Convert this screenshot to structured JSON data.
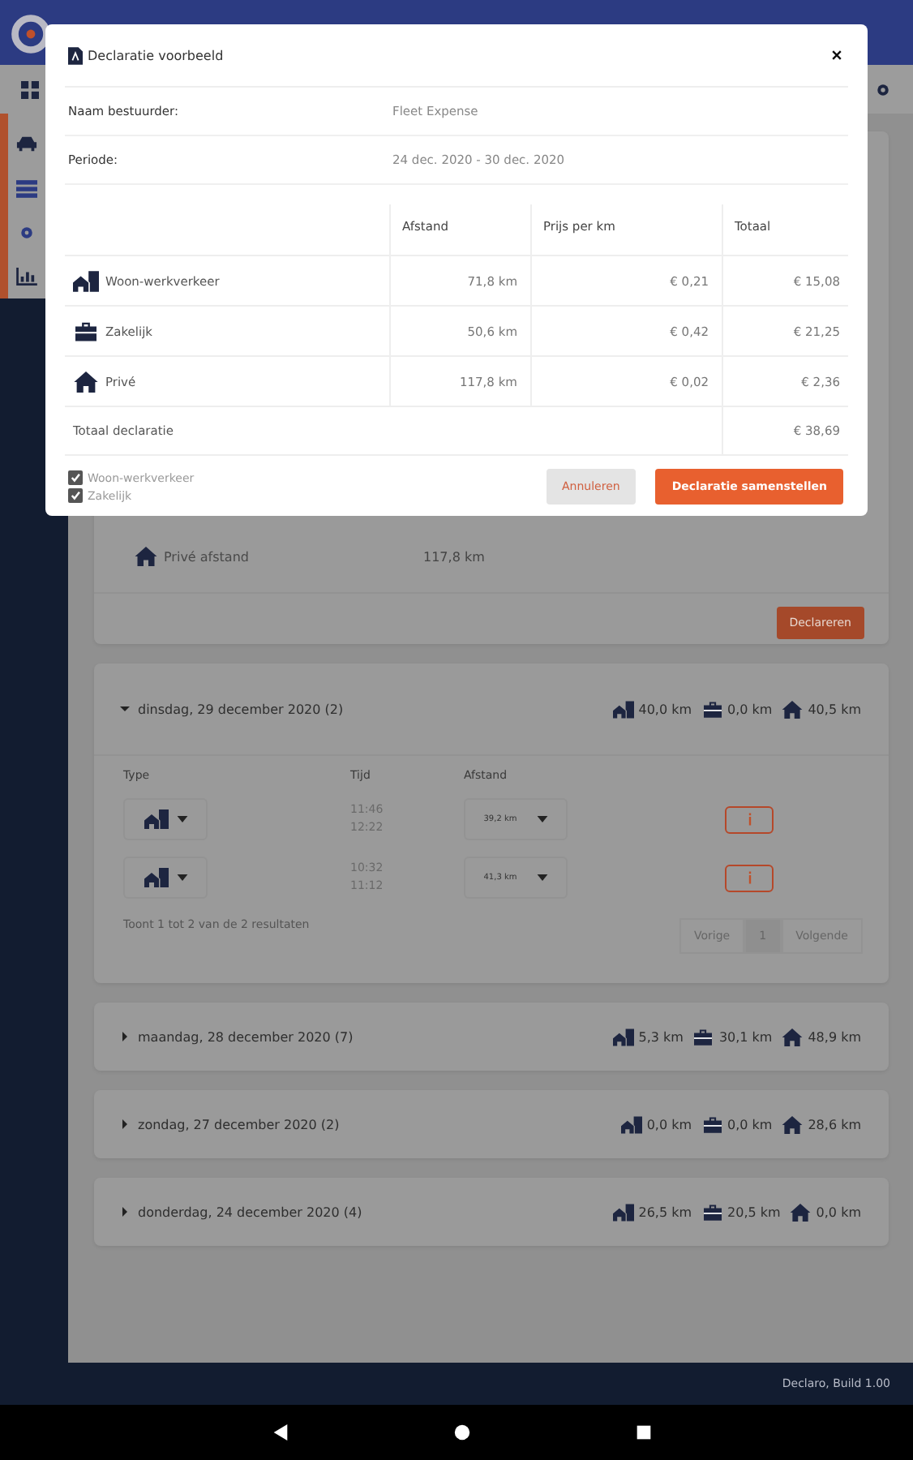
{
  "modal": {
    "title": "Declaratie voorbeeld",
    "fields": [
      {
        "label": "Naam bestuurder:",
        "value": "Fleet Expense"
      },
      {
        "label": "Periode:",
        "value": "24 dec. 2020 - 30 dec. 2020"
      }
    ],
    "columns": [
      "Afstand",
      "Prijs per km",
      "Totaal"
    ],
    "rows": [
      {
        "kind": "woon-werk",
        "label": "Woon-werkverkeer",
        "distance": "71,8 km",
        "price": "€ 0,21",
        "total": "€ 15,08"
      },
      {
        "kind": "zakelijk",
        "label": "Zakelijk",
        "distance": "50,6 km",
        "price": "€ 0,42",
        "total": "€ 21,25"
      },
      {
        "kind": "prive",
        "label": "Privé",
        "distance": "117,8 km",
        "price": "€ 0,02",
        "total": "€ 2,36"
      }
    ],
    "total": {
      "label": "Totaal declaratie",
      "value": "€ 38,69"
    },
    "checkboxes": [
      {
        "label": "Woon-werkverkeer",
        "checked": true
      },
      {
        "label": "Zakelijk",
        "checked": true
      }
    ],
    "cancel_button": "Annuleren",
    "confirm_button": "Declaratie samenstellen"
  },
  "first_card": {
    "rows": [
      {
        "kind": "prive",
        "label": "Privé afstand",
        "value": "117,8 km"
      }
    ],
    "button": "Declareren"
  },
  "days": [
    {
      "title": "dinsdag, 29 december 2020 (2)",
      "expanded": true,
      "totals": [
        {
          "kind": "woon-werk",
          "value": "40,0 km"
        },
        {
          "kind": "zakelijk",
          "value": "0,0 km"
        },
        {
          "kind": "prive",
          "value": "40,5 km"
        }
      ],
      "columns": [
        "Type",
        "Tijd",
        "Afstand"
      ],
      "trips": [
        {
          "kind": "woon-werk",
          "start": "11:46",
          "end": "12:22",
          "distance": "39,2 km"
        },
        {
          "kind": "woon-werk",
          "start": "10:32",
          "end": "11:12",
          "distance": "41,3 km"
        }
      ],
      "result_text": "Toont 1 tot 2 van de 2 resultaten",
      "pager": {
        "prev": "Vorige",
        "pages": [
          {
            "label": "1",
            "selected": true
          }
        ],
        "next": "Volgende"
      }
    },
    {
      "title": "maandag, 28 december 2020 (7)",
      "expanded": false,
      "totals": [
        {
          "kind": "woon-werk",
          "value": "5,3 km"
        },
        {
          "kind": "zakelijk",
          "value": "30,1 km"
        },
        {
          "kind": "prive",
          "value": "48,9 km"
        }
      ]
    },
    {
      "title": "zondag, 27 december 2020 (2)",
      "expanded": false,
      "totals": [
        {
          "kind": "woon-werk",
          "value": "0,0 km"
        },
        {
          "kind": "zakelijk",
          "value": "0,0 km"
        },
        {
          "kind": "prive",
          "value": "28,6 km"
        }
      ]
    },
    {
      "title": "donderdag, 24 december 2020 (4)",
      "expanded": false,
      "totals": [
        {
          "kind": "woon-werk",
          "value": "26,5 km"
        },
        {
          "kind": "zakelijk",
          "value": "20,5 km"
        },
        {
          "kind": "prive",
          "value": "0,0 km"
        }
      ]
    }
  ],
  "footer": "Declaro, Build 1.00"
}
